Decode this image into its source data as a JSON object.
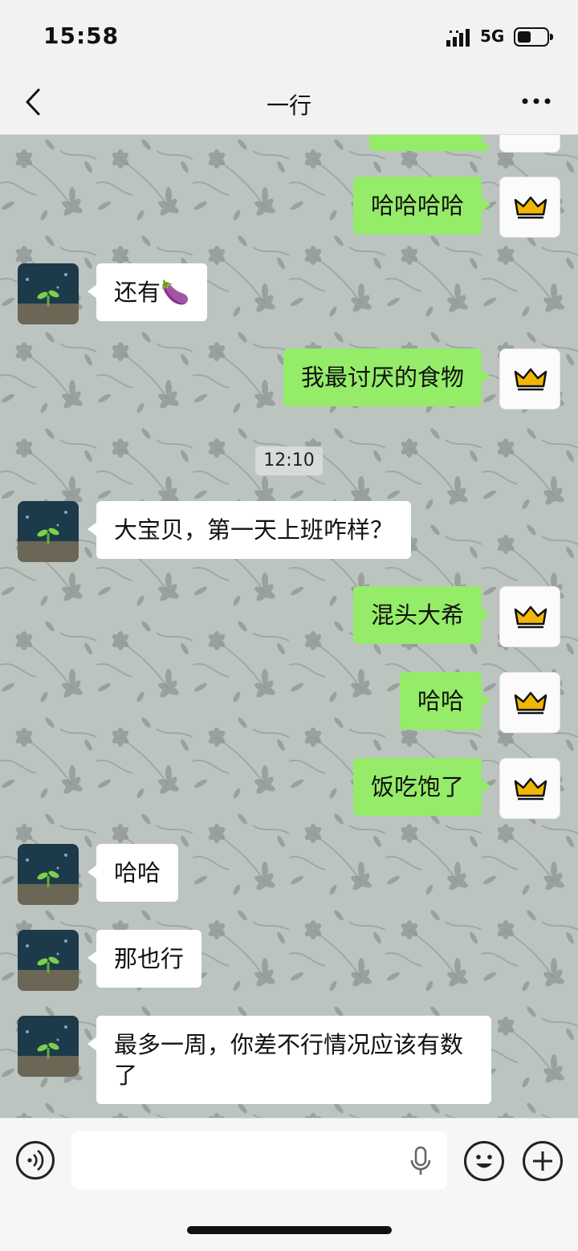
{
  "status_bar": {
    "time": "15:58",
    "network": "5G",
    "battery_percent": 45
  },
  "header": {
    "title": "一行"
  },
  "messages": [
    {
      "from": "me",
      "text": "哈哈哈哈"
    },
    {
      "from": "them",
      "text": "还有🍆"
    },
    {
      "from": "me",
      "text": "我最讨厌的食物"
    },
    {
      "type": "timestamp",
      "text": "12:10"
    },
    {
      "from": "them",
      "text": "大宝贝，第一天上班咋样？"
    },
    {
      "from": "me",
      "text": "混头大希"
    },
    {
      "from": "me",
      "text": "哈哈"
    },
    {
      "from": "me",
      "text": "饭吃饱了"
    },
    {
      "from": "them",
      "text": "哈哈"
    },
    {
      "from": "them",
      "text": "那也行"
    },
    {
      "from": "them",
      "text": "最多一周，你差不行情况应该有数了"
    }
  ],
  "colors": {
    "my_bubble": "#95ec69",
    "their_bubble": "#ffffff",
    "crown": "#f2b705"
  },
  "icons": {
    "back": "chevron-left-icon",
    "more": "more-dots-icon",
    "voice": "voice-icon",
    "mic": "microphone-icon",
    "emoji": "emoji-icon",
    "plus": "plus-icon",
    "my_avatar": "crown-icon",
    "their_avatar": "sprout-icon"
  }
}
